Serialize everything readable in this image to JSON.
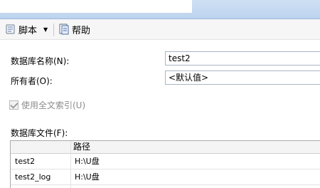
{
  "toolbar": {
    "script_label": "脚本",
    "dropdown_glyph": "▼",
    "help_label": "帮助"
  },
  "form": {
    "db_name_label": "数据库名称(N):",
    "db_name_value": "test2",
    "owner_label": "所有者(O):",
    "owner_value": "<默认值>",
    "fulltext_label": "使用全文索引(U)",
    "fulltext_checked": true,
    "files_label": "数据库文件(F):"
  },
  "files_grid": {
    "columns": [
      "",
      "路径"
    ],
    "rows": [
      {
        "name": "test2",
        "path": "H:\\U盘"
      },
      {
        "name": "test2_log",
        "path": "H:\\U盘"
      }
    ]
  },
  "colors": {
    "title_blue": "#bcd3ef",
    "toolbar_bg": "#f6f6f6",
    "disabled_text": "#8c8c8c"
  },
  "icons": [
    "script-icon",
    "dropdown-arrow-icon",
    "help-icon",
    "checkbox-checked-icon"
  ]
}
